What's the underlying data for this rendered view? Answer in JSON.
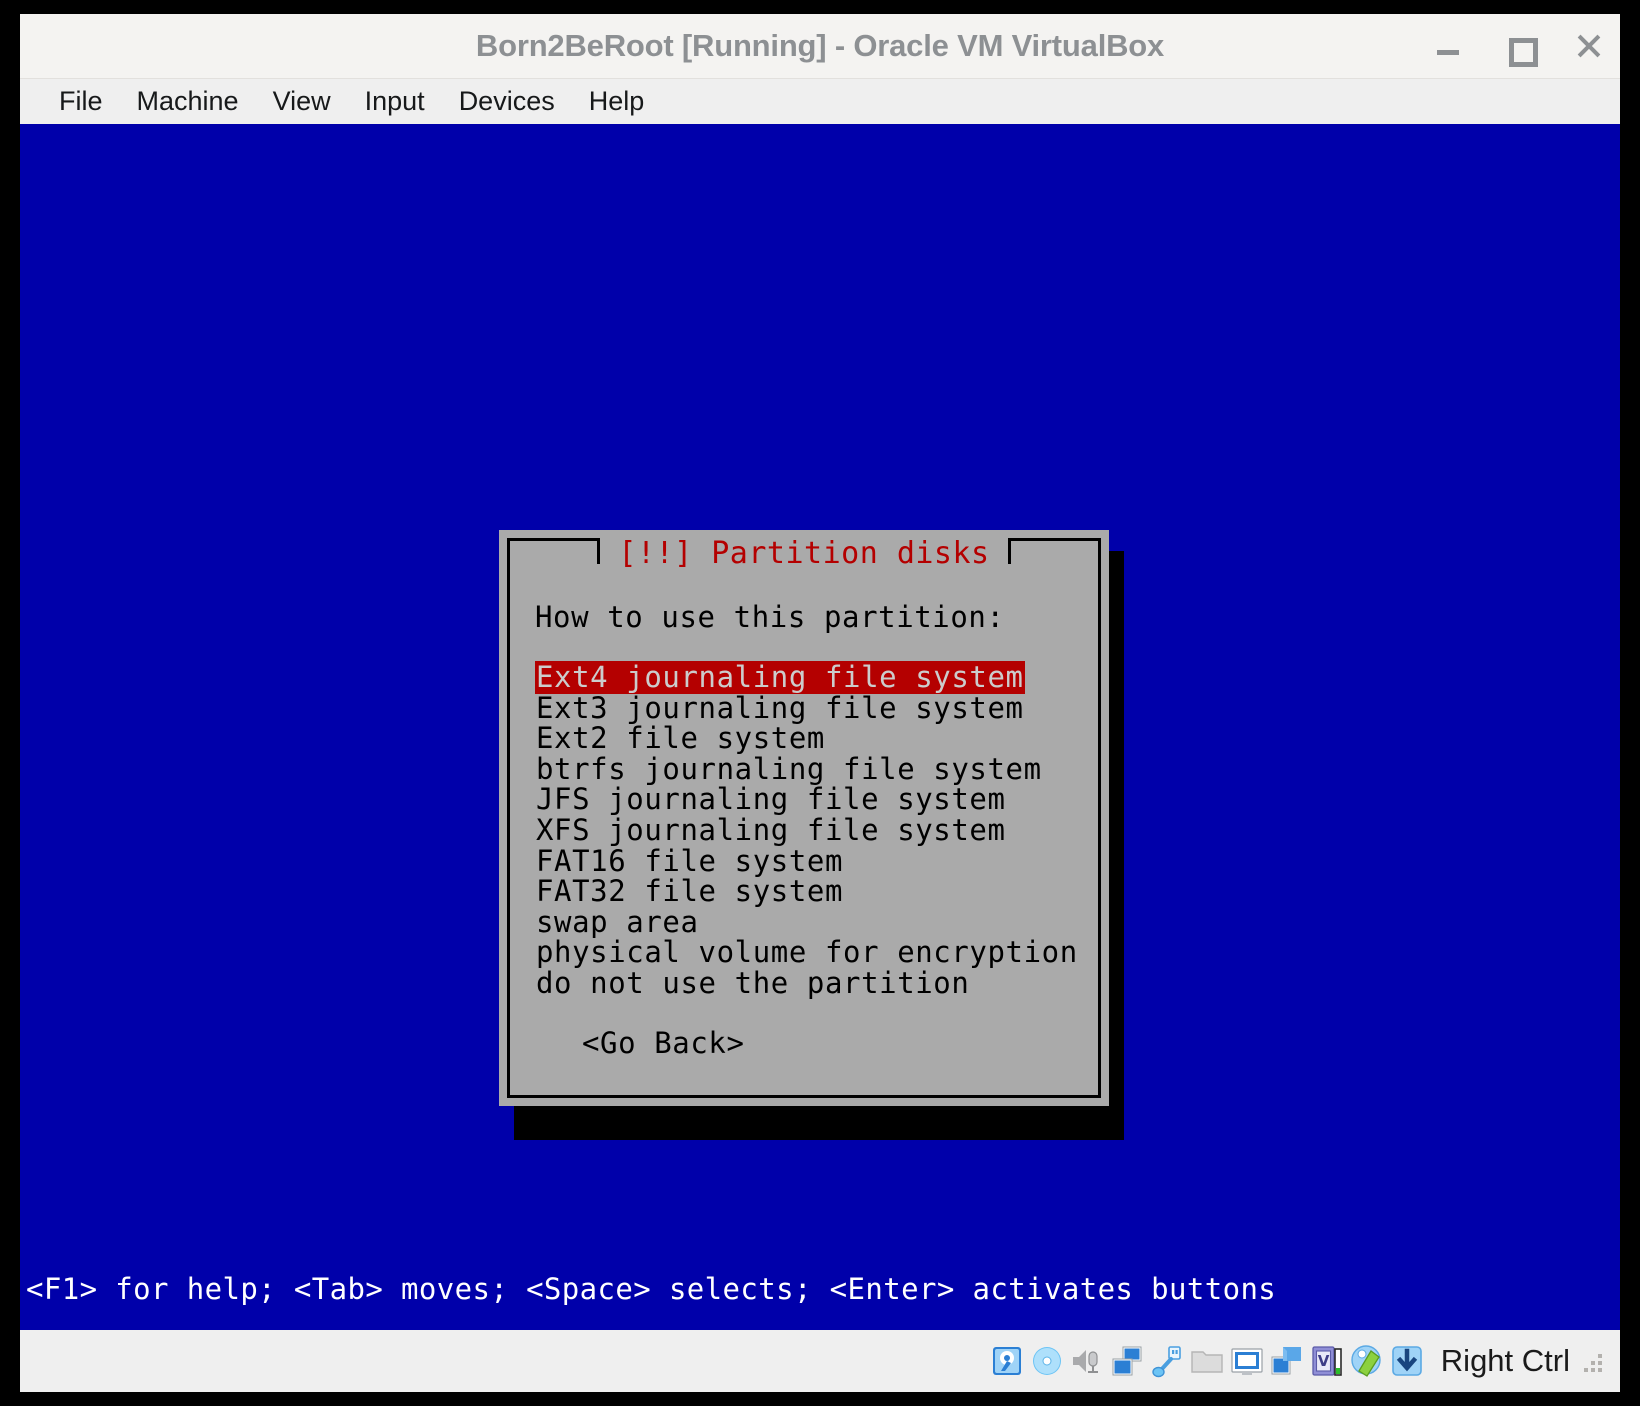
{
  "window": {
    "title": "Born2BeRoot [Running] - Oracle VM VirtualBox",
    "controls": {
      "minimize": "minimize-icon",
      "maximize": "maximize-icon",
      "close": "close-icon"
    }
  },
  "menubar": {
    "items": [
      {
        "label": "File"
      },
      {
        "label": "Machine"
      },
      {
        "label": "View"
      },
      {
        "label": "Input"
      },
      {
        "label": "Devices"
      },
      {
        "label": "Help"
      }
    ]
  },
  "guest": {
    "background_color": "#0000aa",
    "dialog": {
      "title": "[!!] Partition disks",
      "title_color": "#b40000",
      "panel_color": "#aaaaaa",
      "prompt": "How to use this partition:",
      "selected_index": 0,
      "selection_bg": "#b40000",
      "selection_fg": "#cccccc",
      "options": [
        {
          "label": "Ext4 journaling file system"
        },
        {
          "label": "Ext3 journaling file system"
        },
        {
          "label": "Ext2 file system"
        },
        {
          "label": "btrfs journaling file system"
        },
        {
          "label": "JFS journaling file system"
        },
        {
          "label": "XFS journaling file system"
        },
        {
          "label": "FAT16 file system"
        },
        {
          "label": "FAT32 file system"
        },
        {
          "label": "swap area"
        },
        {
          "label": "physical volume for encryption"
        },
        {
          "label": "do not use the partition"
        }
      ],
      "go_back_label": "<Go Back>"
    },
    "help_line": "<F1> for help; <Tab> moves; <Space> selects; <Enter> activates buttons"
  },
  "statusbar": {
    "icons": [
      {
        "name": "hard-disk-icon"
      },
      {
        "name": "optical-disk-icon"
      },
      {
        "name": "audio-icon"
      },
      {
        "name": "network-icon"
      },
      {
        "name": "usb-icon"
      },
      {
        "name": "shared-folders-icon"
      },
      {
        "name": "display-icon"
      },
      {
        "name": "video-capture-icon"
      },
      {
        "name": "virtual-machine-icon"
      },
      {
        "name": "mouse-integration-icon"
      },
      {
        "name": "host-key-icon"
      }
    ],
    "host_key_label": "Right Ctrl"
  }
}
